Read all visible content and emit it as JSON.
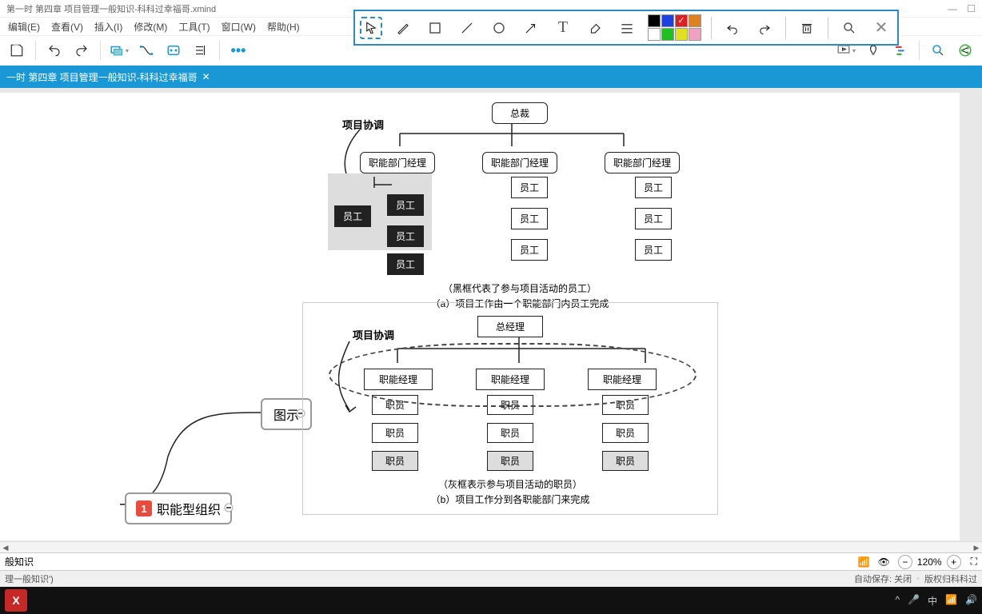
{
  "title": "第一时 第四章 项目管理一般知识-科科过幸福哥.xmind",
  "menubar": [
    "编辑(E)",
    "查看(V)",
    "插入(I)",
    "修改(M)",
    "工具(T)",
    "窗口(W)",
    "帮助(H)"
  ],
  "tab_label": "一时 第四章 项目管理一般知识-科科过幸福哥",
  "annot_colors_row1": [
    "#000000",
    "#1e40e0",
    "#e02020",
    "#e08020"
  ],
  "annot_colors_row2": [
    "#ffffff",
    "#20c020",
    "#e0e020",
    "#f0a0c0"
  ],
  "mindmap": {
    "node_tushi": "图示",
    "node_zhineng": "职能型组织",
    "badge": "1"
  },
  "diagram1": {
    "side_label": "项目协调",
    "top": "总裁",
    "managers": [
      "职能部门经理",
      "职能部门经理",
      "职能部门经理"
    ],
    "staff": "员工",
    "note": "（黑框代表了参与项目活动的员工）",
    "caption": "（a）项目工作由一个职能部门内员工完成"
  },
  "diagram2": {
    "side_label": "项目协调",
    "top": "总经理",
    "managers": [
      "职能经理",
      "职能经理",
      "职能经理"
    ],
    "staff": "职员",
    "note": "（灰框表示参与项目活动的职员）",
    "caption": "（b）项目工作分到各职能部门来完成"
  },
  "footer1_text": "般知识",
  "footer2_left": "理一般知识')",
  "footer2_autosave": "自动保存: 关闭",
  "footer2_copyright": "版权归科科过",
  "zoom": "120%",
  "checked_color": "✓"
}
